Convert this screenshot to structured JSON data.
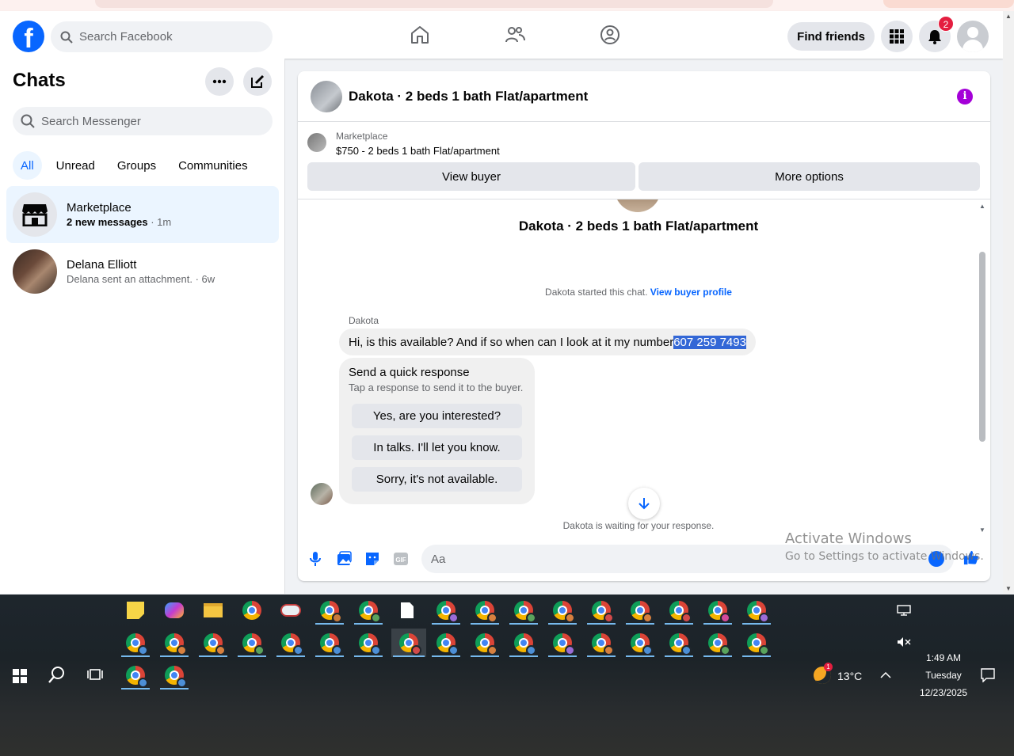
{
  "navbar": {
    "search_placeholder": "Search Facebook",
    "find_friends_label": "Find friends",
    "notification_count": "2",
    "logo_letter": "f"
  },
  "chats": {
    "title": "Chats",
    "search_placeholder": "Search Messenger",
    "filters": [
      "All",
      "Unread",
      "Groups",
      "Communities"
    ],
    "items": [
      {
        "name": "Marketplace",
        "sub_bold": "2 new messages",
        "sub_time": " · 1m"
      },
      {
        "name": "Delana Elliott",
        "sub": "Delana sent an attachment.",
        "sub_time": " · 6w"
      }
    ]
  },
  "conversation": {
    "title": "Dakota · 2 beds 1 bath Flat/apartment",
    "info_glyph": "i",
    "marketplace_label": "Marketplace",
    "listing": "$750 - 2 beds 1 bath Flat/apartment",
    "view_buyer": "View buyer",
    "more_options": "More options",
    "center_title": "Dakota · 2 beds 1 bath Flat/apartment",
    "started_text": "Dakota started this chat.",
    "view_buyer_profile": "View buyer profile",
    "sender": "Dakota",
    "message_text": "Hi, is this available? And if so when can I look at it my number",
    "message_highlight": " 607 259 7493",
    "quick_title": "Send a quick response",
    "quick_sub": "Tap a response to send it to the buyer.",
    "quick_responses": [
      "Yes, are you interested?",
      "In talks. I'll let you know.",
      "Sorry, it's not available."
    ],
    "waiting": "Dakota is waiting for your response.",
    "composer_placeholder": "Aa",
    "gif_label": "GIF"
  },
  "watermark": {
    "line1": "Activate Windows",
    "line2": "Go to Settings to activate Windows."
  },
  "taskbar": {
    "weather_temp": "13°C",
    "weather_badge": "1",
    "time": "1:49 AM",
    "day": "Tuesday",
    "date": "12/23/2025"
  },
  "colors": {
    "brand_blue": "#0866ff",
    "notif_red": "#e41e3f",
    "highlight": "#3367d6",
    "info_purple": "#a400d8"
  }
}
